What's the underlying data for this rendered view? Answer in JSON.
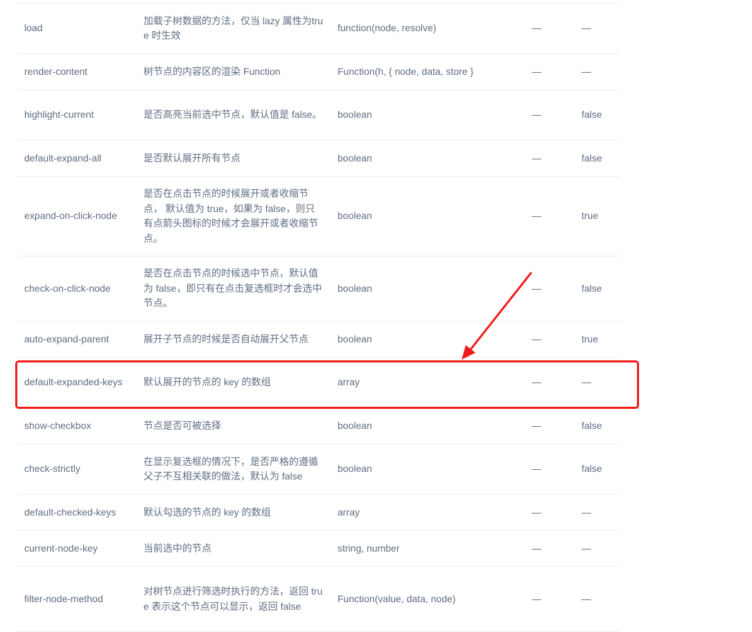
{
  "table": {
    "rows": [
      {
        "param": "load",
        "desc": "加载子树数据的方法，仅当 lazy 属性为true 时生效",
        "type": "function(node, resolve)",
        "options": "—",
        "default": "—"
      },
      {
        "param": "render-content",
        "desc": "树节点的内容区的渲染 Function",
        "type": "Function(h, { node, data, store }",
        "options": "—",
        "default": "—"
      },
      {
        "param": "highlight-current",
        "desc": "是否高亮当前选中节点，默认值是 false。",
        "type": "boolean",
        "options": "—",
        "default": "false"
      },
      {
        "param": "default-expand-all",
        "desc": "是否默认展开所有节点",
        "type": "boolean",
        "options": "—",
        "default": "false"
      },
      {
        "param": "expand-on-click-node",
        "desc": "是否在点击节点的时候展开或者收缩节点， 默认值为 true，如果为 false，则只有点箭头图标的时候才会展开或者收缩节点。",
        "type": "boolean",
        "options": "—",
        "default": "true"
      },
      {
        "param": "check-on-click-node",
        "desc": "是否在点击节点的时候选中节点，默认值为 false，即只有在点击复选框时才会选中节点。",
        "type": "boolean",
        "options": "—",
        "default": "false"
      },
      {
        "param": "auto-expand-parent",
        "desc": "展开子节点的时候是否自动展开父节点",
        "type": "boolean",
        "options": "—",
        "default": "true"
      },
      {
        "param": "default-expanded-keys",
        "desc": "默认展开的节点的 key 的数组",
        "type": "array",
        "options": "—",
        "default": "—"
      },
      {
        "param": "show-checkbox",
        "desc": "节点是否可被选择",
        "type": "boolean",
        "options": "—",
        "default": "false"
      },
      {
        "param": "check-strictly",
        "desc": "在显示复选框的情况下，是否严格的遵循父子不互相关联的做法，默认为 false",
        "type": "boolean",
        "options": "—",
        "default": "false"
      },
      {
        "param": "default-checked-keys",
        "desc": "默认勾选的节点的 key 的数组",
        "type": "array",
        "options": "—",
        "default": "—"
      },
      {
        "param": "current-node-key",
        "desc": "当前选中的节点",
        "type": "string, number",
        "options": "—",
        "default": "—"
      },
      {
        "param": "filter-node-method",
        "desc": "对树节点进行筛选时执行的方法，返回 true 表示这个节点可以显示，返回 false",
        "type": "Function(value, data, node)",
        "options": "—",
        "default": "—"
      }
    ]
  },
  "annotation": {
    "color": "#f11a1a",
    "target": "default-expanded-keys"
  }
}
